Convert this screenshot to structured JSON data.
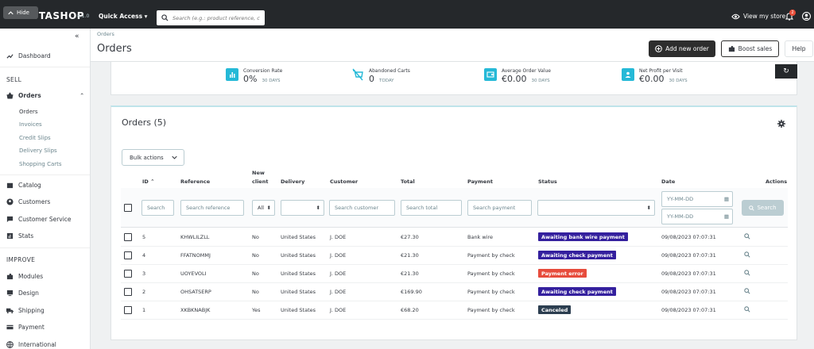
{
  "topbar": {
    "hide_label": "Hide",
    "logo": "PRESTASHOP",
    "version": "8.1.0",
    "quick_access": "Quick Access",
    "search_placeholder": "Search (e.g.: product reference, custo",
    "view_store": "View my store",
    "notifications_count": "2"
  },
  "sidebar": {
    "dashboard": "Dashboard",
    "sell_heading": "SELL",
    "orders": "Orders",
    "orders_sub": [
      "Orders",
      "Invoices",
      "Credit Slips",
      "Delivery Slips",
      "Shopping Carts"
    ],
    "catalog": "Catalog",
    "customers": "Customers",
    "customer_service": "Customer Service",
    "stats": "Stats",
    "improve_heading": "IMPROVE",
    "modules": "Modules",
    "design": "Design",
    "shipping": "Shipping",
    "payment": "Payment",
    "international": "International"
  },
  "header": {
    "breadcrumb": "Orders",
    "title": "Orders",
    "add_new_order": "Add new order",
    "boost_sales": "Boost sales",
    "help": "Help"
  },
  "kpi": [
    {
      "label": "Conversion Rate",
      "value": "0%",
      "sub": "30 DAYS"
    },
    {
      "label": "Abandoned Carts",
      "value": "0",
      "sub": "TODAY"
    },
    {
      "label": "Average Order Value",
      "value": "€0.00",
      "sub": "30 DAYS"
    },
    {
      "label": "Net Profit per Visit",
      "value": "€0.00",
      "sub": "30 DAYS"
    }
  ],
  "card": {
    "title": "Orders (5)",
    "bulk_actions": "Bulk actions"
  },
  "columns": {
    "id": "ID",
    "reference": "Reference",
    "new_client_1": "New",
    "new_client_2": "client",
    "delivery": "Delivery",
    "customer": "Customer",
    "total": "Total",
    "payment": "Payment",
    "status": "Status",
    "date": "Date",
    "actions": "Actions"
  },
  "filters": {
    "id": "Search",
    "reference": "Search reference",
    "new_client": "All",
    "customer": "Search customer",
    "total": "Search total",
    "payment": "Search payment",
    "date_from": "YY-MM-DD",
    "date_to": "YY-MM-DD",
    "search_button": "Search"
  },
  "orders": [
    {
      "id": "5",
      "reference": "KHWLILZLL",
      "new_client": "No",
      "delivery": "United States",
      "customer": "J. DOE",
      "total": "€27.30",
      "payment": "Bank wire",
      "status": "Awaiting bank wire payment",
      "status_color": "#34209e",
      "date": "09/08/2023 07:07:31"
    },
    {
      "id": "4",
      "reference": "FFATNOMMJ",
      "new_client": "No",
      "delivery": "United States",
      "customer": "J. DOE",
      "total": "€21.30",
      "payment": "Payment by check",
      "status": "Awaiting check payment",
      "status_color": "#34209e",
      "date": "09/08/2023 07:07:31"
    },
    {
      "id": "3",
      "reference": "UOYEVOLI",
      "new_client": "No",
      "delivery": "United States",
      "customer": "J. DOE",
      "total": "€21.30",
      "payment": "Payment by check",
      "status": "Payment error",
      "status_color": "#e74c3c",
      "date": "09/08/2023 07:07:31"
    },
    {
      "id": "2",
      "reference": "OHSATSERP",
      "new_client": "No",
      "delivery": "United States",
      "customer": "J. DOE",
      "total": "€169.90",
      "payment": "Payment by check",
      "status": "Awaiting check payment",
      "status_color": "#34209e",
      "date": "09/08/2023 07:07:31"
    },
    {
      "id": "1",
      "reference": "XKBKNABJK",
      "new_client": "Yes",
      "delivery": "United States",
      "customer": "J. DOE",
      "total": "€68.20",
      "payment": "Payment by check",
      "status": "Canceled",
      "status_color": "#2c3e50",
      "date": "09/08/2023 07:07:31"
    }
  ]
}
